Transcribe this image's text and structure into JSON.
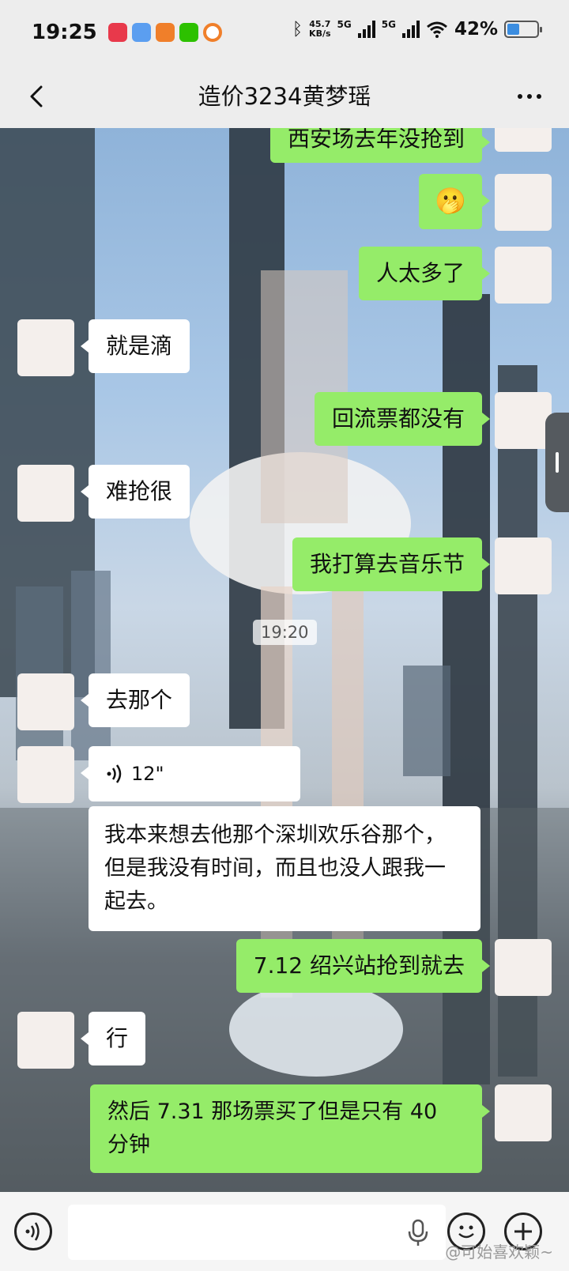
{
  "status_bar": {
    "time": "19:25",
    "speed_top": "45.7",
    "speed_unit": "KB/s",
    "net1": "5G",
    "net2": "5G",
    "battery": "42%",
    "battery_level": 0.42,
    "colors": {
      "battery_fill": "#3b8de0"
    }
  },
  "nav": {
    "title": "造价3234黄梦瑶",
    "back_icon": "chevron-left-icon",
    "more_icon": "more-dots-icon"
  },
  "messages": [
    {
      "side": "right",
      "text": "西安场去年没抢到"
    },
    {
      "side": "right",
      "text": "🫢"
    },
    {
      "side": "right",
      "text": "人太多了"
    },
    {
      "side": "left",
      "text": "就是滴"
    },
    {
      "side": "right",
      "text": "回流票都没有"
    },
    {
      "side": "left",
      "text": "难抢很"
    },
    {
      "side": "right",
      "text": "我打算去音乐节"
    },
    {
      "side": "left",
      "text": "去那个"
    },
    {
      "side": "left",
      "text": "12\""
    },
    {
      "side": "left",
      "text": "我本来想去他那个深圳欢乐谷那个，但是我没有时间，而且也没人跟我一起去。"
    },
    {
      "side": "right",
      "text": "7.12 绍兴站抢到就去"
    },
    {
      "side": "left",
      "text": "行"
    },
    {
      "side": "right",
      "text": "然后 7.31 那场票买了但是只有 40 分钟"
    }
  ],
  "time_divider": "19:20",
  "input_bar": {
    "placeholder": "",
    "voice_icon": "voice-icon",
    "emoji_icon": "emoji-icon",
    "plus_icon": "plus-icon",
    "watermark": "@可始喜欢颖~"
  },
  "colors": {
    "bubble_green": "#95ec69",
    "bubble_white": "#ffffff",
    "bar_bg": "#ededed"
  }
}
